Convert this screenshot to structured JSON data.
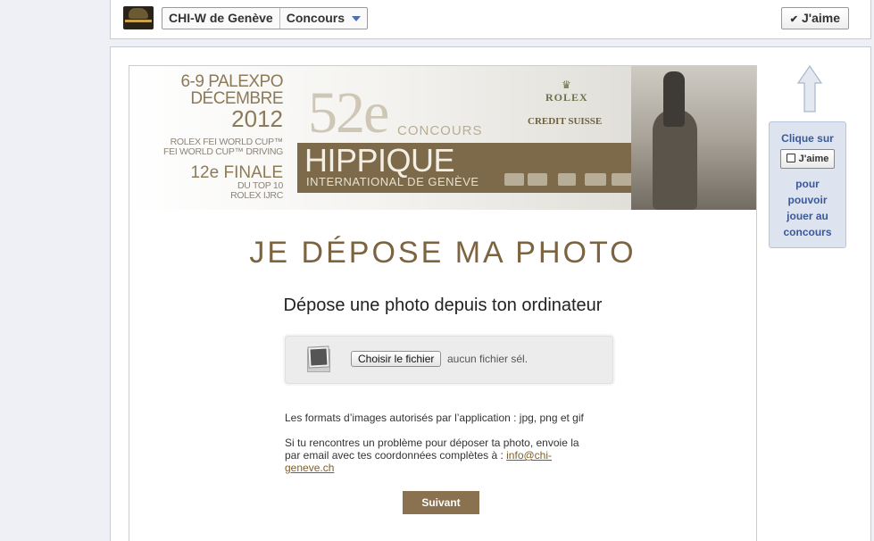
{
  "header": {
    "page_name": "CHI-W de Genève",
    "tab_name": "Concours",
    "like_label": "J'aime"
  },
  "banner": {
    "dates": "6-9",
    "location": "PALEXPO",
    "month": "DÉCEMBRE",
    "year": "2012",
    "world_cup_1": "ROLEX FEI WORLD CUP™",
    "world_cup_2": "FEI WORLD CUP™ DRIVING",
    "finale_number": "12e",
    "finale": "FINALE",
    "top10": "DU TOP 10",
    "ijrc": "ROLEX IJRC",
    "edition": "52e",
    "concours": "CONCOURS",
    "hippique": "HIPPIQUE",
    "international": "INTERNATIONAL DE GENÈVE",
    "sponsor_1": "ROLEX",
    "sponsor_2": "CREDIT SUISSE"
  },
  "form": {
    "heading": "JE DÉPOSE MA PHOTO",
    "subheading": "Dépose une photo depuis ton ordinateur",
    "file_button": "Choisir le fichier",
    "file_status": "aucun fichier sél.",
    "formats_info": "Les formats d’images autorisés par l’application : jpg, png et gif",
    "problem_info": "Si tu rencontres un problème pour déposer ta photo, envoie la par email avec tes coordonnées complètes à : ",
    "email": "info@chi-geneve.ch",
    "next_button": "Suivant"
  },
  "like_prompt": {
    "top": "Clique sur",
    "button_label": "J'aime",
    "line_1": "pour",
    "line_2": "pouvoir",
    "line_3": "jouer au",
    "line_4": "concours"
  },
  "colors": {
    "brand_brown": "#8a7150",
    "heading_brown": "#7d6441",
    "facebook_blue": "#3b5998"
  }
}
